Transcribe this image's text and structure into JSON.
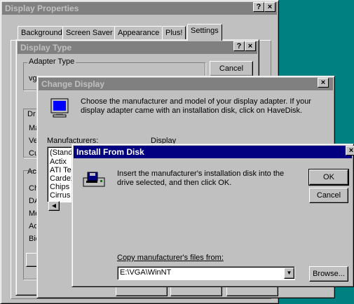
{
  "display_properties": {
    "title": "Display Properties",
    "help_btn": "?",
    "close_btn": "×",
    "tabs": [
      "Background",
      "Screen Saver",
      "Appearance",
      "Plus!",
      "Settings"
    ]
  },
  "display_type": {
    "title": "Display Type",
    "help_btn": "?",
    "close_btn": "×",
    "adapter_type_label": "Adapter Type",
    "adapter_value_partial": "vg",
    "cancel_label": "Cancel",
    "left_fragments": [
      "Dr",
      "Ma",
      "Ve",
      "Cu",
      "Ac",
      "Ch",
      "DA",
      "Me",
      "Ac",
      "Bio"
    ]
  },
  "change_display": {
    "title": "Change Display",
    "close_btn": "×",
    "message": "Choose the manufacturer and model of your display adapter.  If your display adapter came with an installation disk, click on HaveDisk.",
    "manufacturers_label": "Manufacturers:",
    "display_label": "Display",
    "manufacturers": [
      "(Stand",
      "Actix",
      "ATI Te",
      "Cardex",
      "Chips &",
      "Cirrus L"
    ]
  },
  "install_from_disk": {
    "title": "Install From Disk",
    "close_btn": "×",
    "message": "Insert the manufacturer's installation disk into the drive selected, and then click OK.",
    "ok_label": "OK",
    "cancel_label": "Cancel",
    "copy_label": "Copy manufacturer's files from:",
    "path_value": "E:\\VGA\\WinNT",
    "browse_label": "Browse..."
  }
}
